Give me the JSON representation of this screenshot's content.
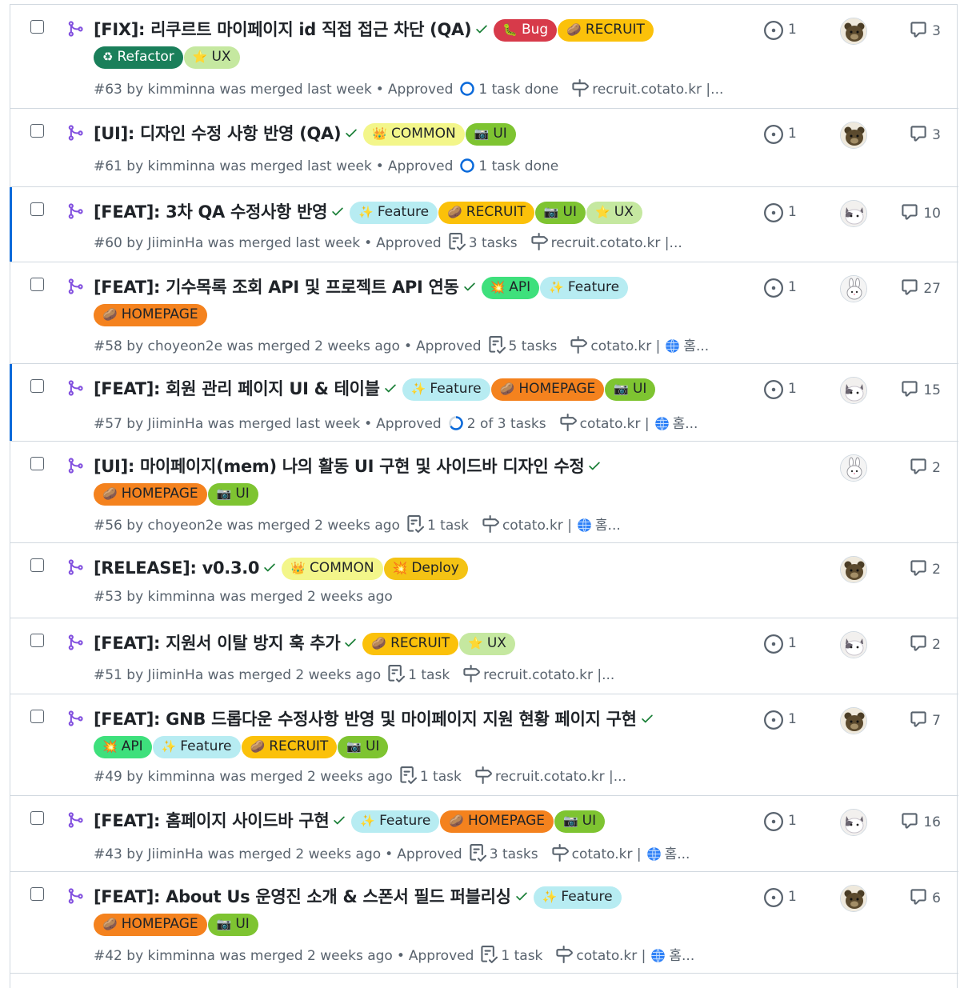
{
  "colors": {
    "bug": "#d73a4a",
    "recruit": "#fbc10a",
    "refactor": "#1a7f5a",
    "ux": "#c5e8a0",
    "common": "#f3f68a",
    "ui": "#7ec431",
    "feature": "#b7ecf2",
    "api": "#3ee07c",
    "homepage": "#f4821e",
    "deploy": "#f4c314",
    "merged": "#8250df",
    "check": "#1a7f37"
  },
  "prs": [
    {
      "title": "[FIX]: 리쿠르트 마이페이지 id 직접 접근 차단 (QA)",
      "labels": [
        {
          "emoji": "🐛",
          "text": "Bug",
          "color": "#d73a4a",
          "fg": "#ffffff"
        },
        {
          "emoji": "🥔",
          "text": "RECRUIT",
          "color": "#fbc10a",
          "fg": "#1f2328"
        },
        {
          "emoji": "♻",
          "text": "Refactor",
          "color": "#1a7f5a",
          "fg": "#ffffff"
        },
        {
          "emoji": "⭐",
          "text": "UX",
          "color": "#c5e8a0",
          "fg": "#1f2328"
        }
      ],
      "meta": "#63 by kimminna was merged last week",
      "approved": "Approved",
      "tasks": "1 task done",
      "task_icon": "done-circle",
      "link": "recruit.cotato.kr |...",
      "link_extra": "",
      "issues": "1",
      "avatar": "bear",
      "comments": "3",
      "active": false
    },
    {
      "title": "[UI]: 디자인 수정 사항 반영 (QA)",
      "labels": [
        {
          "emoji": "👑",
          "text": "COMMON",
          "color": "#f3f68a",
          "fg": "#1f2328"
        },
        {
          "emoji": "📷",
          "text": "UI",
          "color": "#7ec431",
          "fg": "#1f2328"
        }
      ],
      "meta": "#61 by kimminna was merged last week",
      "approved": "Approved",
      "tasks": "1 task done",
      "task_icon": "done-circle",
      "link": "",
      "link_extra": "",
      "issues": "1",
      "avatar": "bear",
      "comments": "3",
      "active": false
    },
    {
      "title": "[FEAT]: 3차 QA 수정사항 반영",
      "labels": [
        {
          "emoji": "✨",
          "text": "Feature",
          "color": "#b7ecf2",
          "fg": "#1f2328"
        },
        {
          "emoji": "🥔",
          "text": "RECRUIT",
          "color": "#fbc10a",
          "fg": "#1f2328"
        },
        {
          "emoji": "📷",
          "text": "UI",
          "color": "#7ec431",
          "fg": "#1f2328"
        },
        {
          "emoji": "⭐",
          "text": "UX",
          "color": "#c5e8a0",
          "fg": "#1f2328"
        }
      ],
      "meta": "#60 by JiiminHa was merged last week",
      "approved": "Approved",
      "tasks": "3 tasks",
      "task_icon": "checklist",
      "link": "recruit.cotato.kr |...",
      "link_extra": "",
      "issues": "1",
      "avatar": "cat",
      "comments": "10",
      "active": true
    },
    {
      "title": "[FEAT]: 기수목록 조회 API 및 프로젝트 API 연동",
      "labels": [
        {
          "emoji": "💥",
          "text": "API",
          "color": "#3ee07c",
          "fg": "#1f2328"
        },
        {
          "emoji": "✨",
          "text": "Feature",
          "color": "#b7ecf2",
          "fg": "#1f2328"
        },
        {
          "emoji": "🥔",
          "text": "HOMEPAGE",
          "color": "#f4821e",
          "fg": "#1f2328"
        }
      ],
      "meta": "#58 by choyeon2e was merged 2 weeks ago",
      "approved": "Approved",
      "tasks": "5 tasks",
      "task_icon": "checklist",
      "link": "cotato.kr |",
      "link_extra": "홈...",
      "issues": "1",
      "avatar": "rabbit",
      "comments": "27",
      "active": false
    },
    {
      "title": "[FEAT]: 회원 관리 페이지 UI & 테이블",
      "labels": [
        {
          "emoji": "✨",
          "text": "Feature",
          "color": "#b7ecf2",
          "fg": "#1f2328"
        },
        {
          "emoji": "🥔",
          "text": "HOMEPAGE",
          "color": "#f4821e",
          "fg": "#1f2328"
        },
        {
          "emoji": "📷",
          "text": "UI",
          "color": "#7ec431",
          "fg": "#1f2328"
        }
      ],
      "meta": "#57 by JiiminHa was merged last week",
      "approved": "Approved",
      "tasks": "2 of 3 tasks",
      "task_icon": "progress",
      "link": "cotato.kr |",
      "link_extra": "홈...",
      "issues": "1",
      "avatar": "cat",
      "comments": "15",
      "active": true
    },
    {
      "title": "[UI]: 마이페이지(mem) 나의 활동 UI 구현 및 사이드바 디자인 수정",
      "labels": [
        {
          "emoji": "🥔",
          "text": "HOMEPAGE",
          "color": "#f4821e",
          "fg": "#1f2328"
        },
        {
          "emoji": "📷",
          "text": "UI",
          "color": "#7ec431",
          "fg": "#1f2328"
        }
      ],
      "meta": "#56 by choyeon2e was merged 2 weeks ago",
      "approved": "",
      "tasks": "1 task",
      "task_icon": "checklist",
      "link": "cotato.kr |",
      "link_extra": "홈...",
      "issues": "",
      "avatar": "rabbit",
      "comments": "2",
      "active": false
    },
    {
      "title": "[RELEASE]: v0.3.0",
      "labels": [
        {
          "emoji": "👑",
          "text": "COMMON",
          "color": "#f3f68a",
          "fg": "#1f2328"
        },
        {
          "emoji": "💥",
          "text": "Deploy",
          "color": "#f4c314",
          "fg": "#1f2328"
        }
      ],
      "meta": "#53 by kimminna was merged 2 weeks ago",
      "approved": "",
      "tasks": "",
      "task_icon": "",
      "link": "",
      "link_extra": "",
      "issues": "",
      "avatar": "bear",
      "comments": "2",
      "active": false
    },
    {
      "title": "[FEAT]: 지원서 이탈 방지 훅 추가",
      "labels": [
        {
          "emoji": "🥔",
          "text": "RECRUIT",
          "color": "#fbc10a",
          "fg": "#1f2328"
        },
        {
          "emoji": "⭐",
          "text": "UX",
          "color": "#c5e8a0",
          "fg": "#1f2328"
        }
      ],
      "meta": "#51 by JiiminHa was merged 2 weeks ago",
      "approved": "",
      "tasks": "1 task",
      "task_icon": "checklist",
      "link": "recruit.cotato.kr |...",
      "link_extra": "",
      "issues": "1",
      "avatar": "cat",
      "comments": "2",
      "active": false
    },
    {
      "title": "[FEAT]: GNB 드롭다운 수정사항 반영 및 마이페이지 지원 현황 페이지 구현",
      "labels": [
        {
          "emoji": "💥",
          "text": "API",
          "color": "#3ee07c",
          "fg": "#1f2328"
        },
        {
          "emoji": "✨",
          "text": "Feature",
          "color": "#b7ecf2",
          "fg": "#1f2328"
        },
        {
          "emoji": "🥔",
          "text": "RECRUIT",
          "color": "#fbc10a",
          "fg": "#1f2328"
        },
        {
          "emoji": "📷",
          "text": "UI",
          "color": "#7ec431",
          "fg": "#1f2328"
        }
      ],
      "meta": "#49 by kimminna was merged 2 weeks ago",
      "approved": "",
      "tasks": "1 task",
      "task_icon": "checklist",
      "link": "recruit.cotato.kr |...",
      "link_extra": "",
      "issues": "1",
      "avatar": "bear",
      "comments": "7",
      "active": false
    },
    {
      "title": "[FEAT]: 홈페이지 사이드바 구현",
      "labels": [
        {
          "emoji": "✨",
          "text": "Feature",
          "color": "#b7ecf2",
          "fg": "#1f2328"
        },
        {
          "emoji": "🥔",
          "text": "HOMEPAGE",
          "color": "#f4821e",
          "fg": "#1f2328"
        },
        {
          "emoji": "📷",
          "text": "UI",
          "color": "#7ec431",
          "fg": "#1f2328"
        }
      ],
      "meta": "#43 by JiiminHa was merged 2 weeks ago",
      "approved": "Approved",
      "tasks": "3 tasks",
      "task_icon": "checklist",
      "link": "cotato.kr |",
      "link_extra": "홈...",
      "issues": "1",
      "avatar": "cat",
      "comments": "16",
      "active": false
    },
    {
      "title": "[FEAT]: About Us 운영진 소개 & 스폰서 필드 퍼블리싱",
      "labels": [
        {
          "emoji": "✨",
          "text": "Feature",
          "color": "#b7ecf2",
          "fg": "#1f2328"
        },
        {
          "emoji": "🥔",
          "text": "HOMEPAGE",
          "color": "#f4821e",
          "fg": "#1f2328"
        },
        {
          "emoji": "📷",
          "text": "UI",
          "color": "#7ec431",
          "fg": "#1f2328"
        }
      ],
      "meta": "#42 by kimminna was merged 2 weeks ago",
      "approved": "Approved",
      "tasks": "1 task",
      "task_icon": "checklist",
      "link": "cotato.kr |",
      "link_extra": "홈...",
      "issues": "1",
      "avatar": "bear",
      "comments": "6",
      "active": false
    }
  ]
}
